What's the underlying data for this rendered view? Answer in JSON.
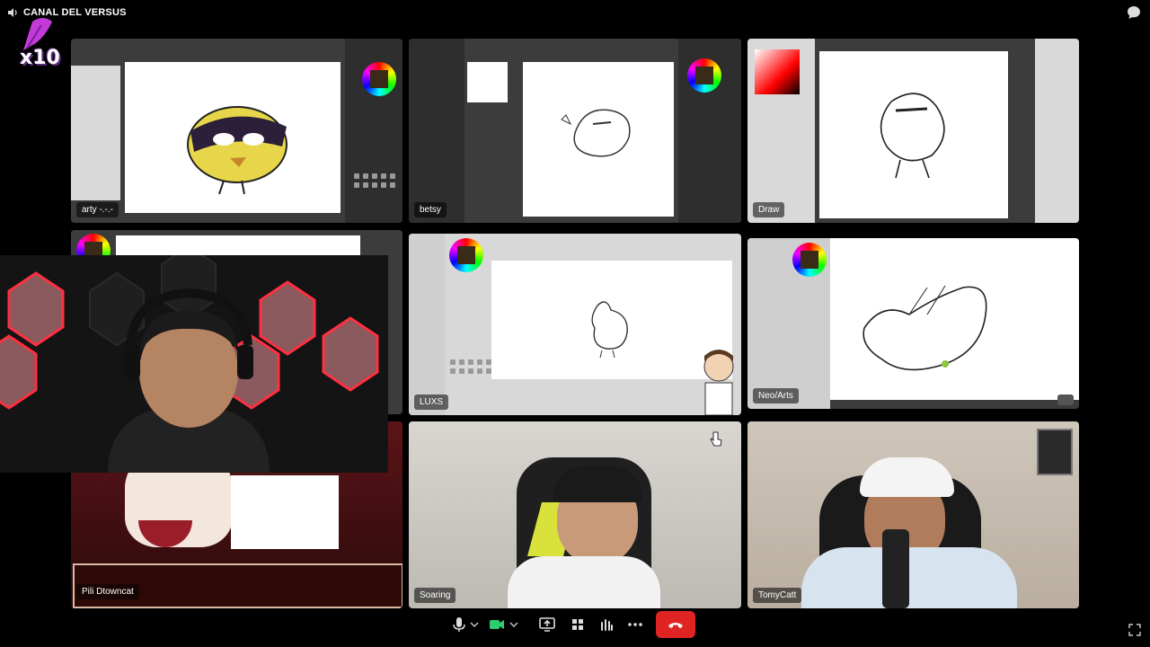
{
  "channel": {
    "name": "CANAL DEL VERSUS"
  },
  "logo": {
    "text": "x10"
  },
  "tiles": {
    "arty": {
      "label": "arty -.-.-"
    },
    "betsy": {
      "label": "betsy"
    },
    "draw": {
      "label": "Draw"
    },
    "luxs": {
      "label": "LUXS"
    },
    "neo": {
      "label": "Neo/Arts"
    },
    "pili": {
      "label": "Pili Dtowncat"
    },
    "soaring": {
      "label": "Soaring"
    },
    "tomy": {
      "label": "TomyCatt"
    }
  },
  "colors": {
    "hangup": "#e02424",
    "accent_green": "#2ecc71",
    "logo_purple": "#c23bd8"
  },
  "icons": [
    "speaker-icon",
    "chat-icon",
    "mic-icon",
    "chevron-down-icon",
    "camera-icon",
    "screen-share-icon",
    "grid-icon",
    "effects-icon",
    "more-icon",
    "hangup-icon",
    "expand-icon"
  ]
}
